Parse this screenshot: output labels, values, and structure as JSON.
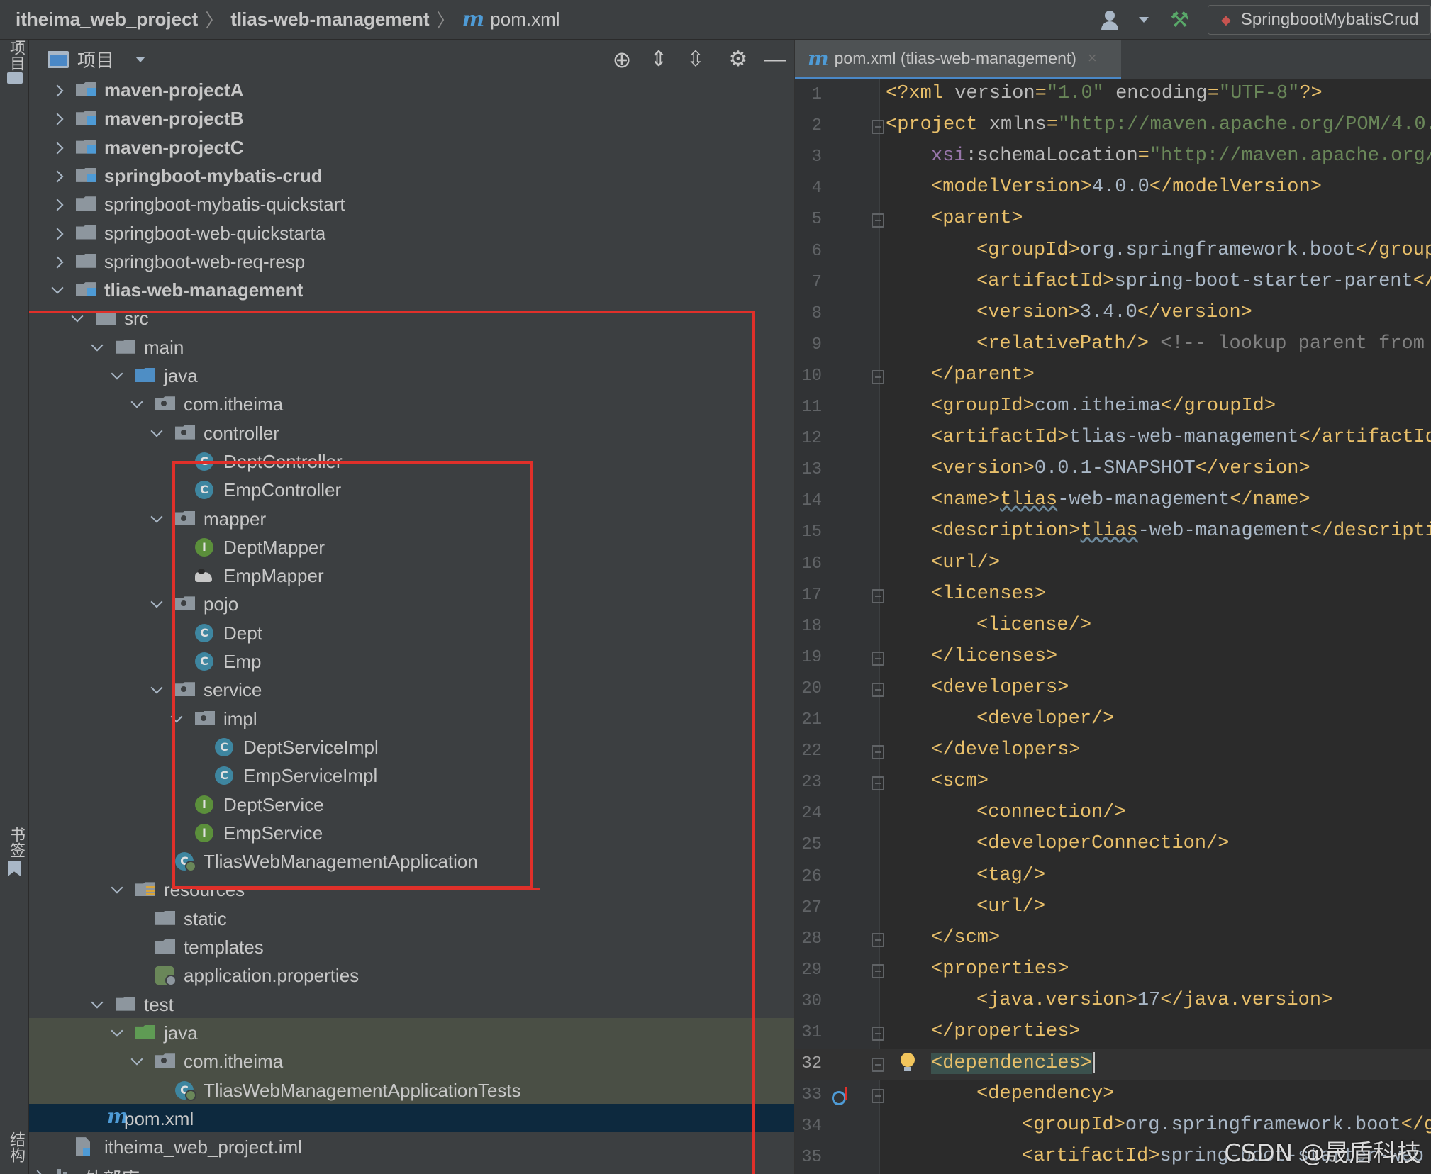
{
  "topbar": {
    "crumbs": [
      "itheima_web_project",
      "tlias-web-management",
      "pom.xml"
    ],
    "run_config": "SpringbootMybatisCrud",
    "accent": "#4e9bd6"
  },
  "stripe": {
    "project_label": "项目",
    "bookmarks_label": "书签",
    "structure_label": "结构"
  },
  "panel": {
    "title": "项目",
    "tools": [
      "locate-icon",
      "expand-all-icon",
      "collapse-all-icon",
      "gear-icon",
      "minimize-icon"
    ]
  },
  "tree": [
    {
      "label": "maven-projectA",
      "icon": "module",
      "depth": 0,
      "state": "collapsed",
      "bold": true
    },
    {
      "label": "maven-projectB",
      "icon": "module",
      "depth": 0,
      "state": "collapsed",
      "bold": true
    },
    {
      "label": "maven-projectC",
      "icon": "module",
      "depth": 0,
      "state": "collapsed",
      "bold": true
    },
    {
      "label": "springboot-mybatis-crud",
      "icon": "module",
      "depth": 0,
      "state": "collapsed",
      "bold": true
    },
    {
      "label": "springboot-mybatis-quickstart",
      "icon": "folder",
      "depth": 0,
      "state": "collapsed",
      "bold": false
    },
    {
      "label": "springboot-web-quickstarta",
      "icon": "folder",
      "depth": 0,
      "state": "collapsed",
      "bold": false
    },
    {
      "label": "springboot-web-req-resp",
      "icon": "folder",
      "depth": 0,
      "state": "collapsed",
      "bold": false
    },
    {
      "label": "tlias-web-management",
      "icon": "module",
      "depth": 0,
      "state": "expanded",
      "bold": true
    },
    {
      "label": "src",
      "icon": "folder",
      "depth": 1,
      "state": "expanded"
    },
    {
      "label": "main",
      "icon": "folder",
      "depth": 2,
      "state": "expanded"
    },
    {
      "label": "java",
      "icon": "src",
      "depth": 3,
      "state": "expanded"
    },
    {
      "label": "com.itheima",
      "icon": "pkg",
      "depth": 4,
      "state": "expanded"
    },
    {
      "label": "controller",
      "icon": "pkg",
      "depth": 5,
      "state": "expanded"
    },
    {
      "label": "DeptController",
      "icon": "class",
      "depth": 6,
      "state": "leaf"
    },
    {
      "label": "EmpController",
      "icon": "class",
      "depth": 6,
      "state": "leaf"
    },
    {
      "label": "mapper",
      "icon": "pkg",
      "depth": 5,
      "state": "expanded"
    },
    {
      "label": "DeptMapper",
      "icon": "interface",
      "depth": 6,
      "state": "leaf"
    },
    {
      "label": "EmpMapper",
      "icon": "mapper",
      "depth": 6,
      "state": "leaf"
    },
    {
      "label": "pojo",
      "icon": "pkg",
      "depth": 5,
      "state": "expanded"
    },
    {
      "label": "Dept",
      "icon": "class",
      "depth": 6,
      "state": "leaf"
    },
    {
      "label": "Emp",
      "icon": "class",
      "depth": 6,
      "state": "leaf"
    },
    {
      "label": "service",
      "icon": "pkg",
      "depth": 5,
      "state": "expanded"
    },
    {
      "label": "impl",
      "icon": "pkg",
      "depth": 6,
      "state": "expanded"
    },
    {
      "label": "DeptServiceImpl",
      "icon": "class",
      "depth": 7,
      "state": "leaf"
    },
    {
      "label": "EmpServiceImpl",
      "icon": "class",
      "depth": 7,
      "state": "leaf"
    },
    {
      "label": "DeptService",
      "icon": "interface",
      "depth": 6,
      "state": "leaf"
    },
    {
      "label": "EmpService",
      "icon": "interface",
      "depth": 6,
      "state": "leaf"
    },
    {
      "label": "TliasWebManagementApplication",
      "icon": "app",
      "depth": 5,
      "state": "leaf"
    },
    {
      "label": "resources",
      "icon": "res",
      "depth": 3,
      "state": "expanded"
    },
    {
      "label": "static",
      "icon": "folder",
      "depth": 4,
      "state": "leaf"
    },
    {
      "label": "templates",
      "icon": "folder",
      "depth": 4,
      "state": "leaf"
    },
    {
      "label": "application.properties",
      "icon": "props",
      "depth": 4,
      "state": "leaf"
    },
    {
      "label": "test",
      "icon": "folder",
      "depth": 2,
      "state": "expanded"
    },
    {
      "label": "java",
      "icon": "testsrc",
      "depth": 3,
      "state": "expanded",
      "highlight": true
    },
    {
      "label": "com.itheima",
      "icon": "pkg",
      "depth": 4,
      "state": "expanded",
      "highlight": true
    },
    {
      "label": "TliasWebManagementApplicationTests",
      "icon": "app",
      "depth": 5,
      "state": "leaf",
      "highlight": true
    },
    {
      "label": "pom.xml",
      "icon": "maven",
      "depth": 1,
      "state": "leaf",
      "selected": true
    },
    {
      "label": "itheima_web_project.iml",
      "icon": "iml",
      "depth": 0,
      "state": "leaf"
    },
    {
      "label": "外部库",
      "icon": "lib",
      "depth": -1,
      "state": "collapsed"
    }
  ],
  "editor": {
    "tab_label": "pom.xml (tlias-web-management)",
    "close_glyph": "×",
    "current_line": 32,
    "lines": [
      {
        "n": 1,
        "indent": 0,
        "html": "<?xml version=\"1.0\" encoding=\"UTF-8\"?>",
        "parts": [
          [
            "tag",
            "<?xml "
          ],
          [
            "attr",
            "version"
          ],
          [
            "tag",
            "="
          ],
          [
            "val",
            "\"1.0\""
          ],
          [
            "tag",
            " "
          ],
          [
            "attr",
            "encoding"
          ],
          [
            "tag",
            "="
          ],
          [
            "val",
            "\"UTF-8\""
          ],
          [
            "tag",
            "?>"
          ]
        ]
      },
      {
        "n": 2,
        "indent": 0,
        "fold": true,
        "parts": [
          [
            "tag",
            "<project "
          ],
          [
            "attr",
            "xmlns"
          ],
          [
            "tag",
            "="
          ],
          [
            "val",
            "\"http://maven.apache.org/POM/4.0."
          ]
        ]
      },
      {
        "n": 3,
        "indent": 1,
        "parts": [
          [
            "ns",
            "xsi"
          ],
          [
            "attr",
            ":schemaLocation"
          ],
          [
            "tag",
            "="
          ],
          [
            "val",
            "\"http://maven.apache.org/"
          ]
        ]
      },
      {
        "n": 4,
        "indent": 1,
        "parts": [
          [
            "tag",
            "<modelVersion>"
          ],
          [
            "txt",
            "4.0.0"
          ],
          [
            "tag",
            "</modelVersion>"
          ]
        ]
      },
      {
        "n": 5,
        "indent": 1,
        "fold": true,
        "parts": [
          [
            "tag",
            "<parent>"
          ]
        ]
      },
      {
        "n": 6,
        "indent": 2,
        "parts": [
          [
            "tag",
            "<groupId>"
          ],
          [
            "txt",
            "org.springframework.boot"
          ],
          [
            "tag",
            "</group"
          ]
        ]
      },
      {
        "n": 7,
        "indent": 2,
        "parts": [
          [
            "tag",
            "<artifactId>"
          ],
          [
            "txt",
            "spring-boot-starter-parent"
          ],
          [
            "tag",
            "</"
          ]
        ]
      },
      {
        "n": 8,
        "indent": 2,
        "parts": [
          [
            "tag",
            "<version>"
          ],
          [
            "txt",
            "3.4.0"
          ],
          [
            "tag",
            "</version>"
          ]
        ]
      },
      {
        "n": 9,
        "indent": 2,
        "parts": [
          [
            "tag",
            "<relativePath/> "
          ],
          [
            "cm",
            "<!-- lookup parent from"
          ]
        ]
      },
      {
        "n": 10,
        "indent": 1,
        "fold": true,
        "parts": [
          [
            "tag",
            "</parent>"
          ]
        ]
      },
      {
        "n": 11,
        "indent": 1,
        "parts": [
          [
            "tag",
            "<groupId>"
          ],
          [
            "txt",
            "com.itheima"
          ],
          [
            "tag",
            "</groupId>"
          ]
        ]
      },
      {
        "n": 12,
        "indent": 1,
        "parts": [
          [
            "tag",
            "<artifactId>"
          ],
          [
            "txt",
            "tlias-web-management"
          ],
          [
            "tag",
            "</artifactId"
          ]
        ]
      },
      {
        "n": 13,
        "indent": 1,
        "parts": [
          [
            "tag",
            "<version>"
          ],
          [
            "txt",
            "0.0.1-SNAPSHOT"
          ],
          [
            "tag",
            "</version>"
          ]
        ]
      },
      {
        "n": 14,
        "indent": 1,
        "parts": [
          [
            "tag",
            "<name>"
          ],
          [
            "squig",
            "tlias"
          ],
          [
            "txt",
            "-web-management"
          ],
          [
            "tag",
            "</name>"
          ]
        ]
      },
      {
        "n": 15,
        "indent": 1,
        "parts": [
          [
            "tag",
            "<description>"
          ],
          [
            "squig",
            "tlias"
          ],
          [
            "txt",
            "-web-management"
          ],
          [
            "tag",
            "</descripti"
          ]
        ]
      },
      {
        "n": 16,
        "indent": 1,
        "parts": [
          [
            "tag",
            "<url/>"
          ]
        ]
      },
      {
        "n": 17,
        "indent": 1,
        "fold": true,
        "parts": [
          [
            "tag",
            "<licenses>"
          ]
        ]
      },
      {
        "n": 18,
        "indent": 2,
        "parts": [
          [
            "tag",
            "<license/>"
          ]
        ]
      },
      {
        "n": 19,
        "indent": 1,
        "fold": true,
        "parts": [
          [
            "tag",
            "</licenses>"
          ]
        ]
      },
      {
        "n": 20,
        "indent": 1,
        "fold": true,
        "parts": [
          [
            "tag",
            "<developers>"
          ]
        ]
      },
      {
        "n": 21,
        "indent": 2,
        "parts": [
          [
            "tag",
            "<developer/>"
          ]
        ]
      },
      {
        "n": 22,
        "indent": 1,
        "fold": true,
        "parts": [
          [
            "tag",
            "</developers>"
          ]
        ]
      },
      {
        "n": 23,
        "indent": 1,
        "fold": true,
        "parts": [
          [
            "tag",
            "<scm>"
          ]
        ]
      },
      {
        "n": 24,
        "indent": 2,
        "parts": [
          [
            "tag",
            "<connection/>"
          ]
        ]
      },
      {
        "n": 25,
        "indent": 2,
        "parts": [
          [
            "tag",
            "<developerConnection/>"
          ]
        ]
      },
      {
        "n": 26,
        "indent": 2,
        "parts": [
          [
            "tag",
            "<tag/>"
          ]
        ]
      },
      {
        "n": 27,
        "indent": 2,
        "parts": [
          [
            "tag",
            "<url/>"
          ]
        ]
      },
      {
        "n": 28,
        "indent": 1,
        "fold": true,
        "parts": [
          [
            "tag",
            "</scm>"
          ]
        ]
      },
      {
        "n": 29,
        "indent": 1,
        "fold": true,
        "parts": [
          [
            "tag",
            "<properties>"
          ]
        ]
      },
      {
        "n": 30,
        "indent": 2,
        "parts": [
          [
            "tag",
            "<java.version>"
          ],
          [
            "txt",
            "17"
          ],
          [
            "tag",
            "</java.version>"
          ]
        ]
      },
      {
        "n": 31,
        "indent": 1,
        "fold": true,
        "parts": [
          [
            "tag",
            "</properties>"
          ]
        ]
      },
      {
        "n": 32,
        "indent": 1,
        "fold": true,
        "bulb": true,
        "parts": [
          [
            "curhl",
            "<dependencies>"
          ]
        ]
      },
      {
        "n": 33,
        "indent": 2,
        "fold": true,
        "impl": true,
        "parts": [
          [
            "tag",
            "<dependency>"
          ]
        ]
      },
      {
        "n": 34,
        "indent": 3,
        "parts": [
          [
            "tag",
            "<groupId>"
          ],
          [
            "txt",
            "org.springframework.boot"
          ],
          [
            "tag",
            "</g"
          ]
        ]
      },
      {
        "n": 35,
        "indent": 3,
        "parts": [
          [
            "tag",
            "<artifactId>"
          ],
          [
            "txt",
            "spring-boot-starter-web"
          ]
        ]
      }
    ]
  },
  "watermark": "CSDN @晟盾科技",
  "colors": {
    "annotation": "#e0302a",
    "selection": "#0d293e",
    "highlight": "#4a4f45"
  }
}
